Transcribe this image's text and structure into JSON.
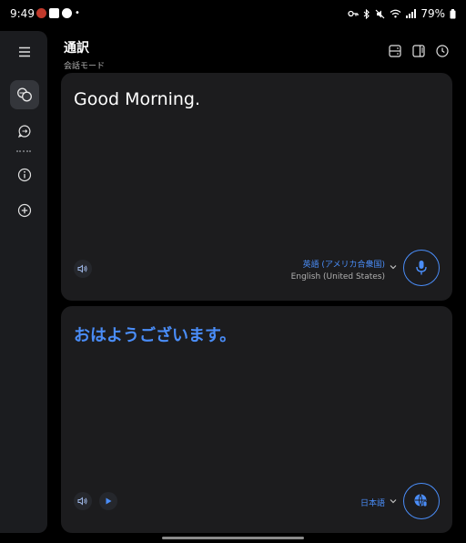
{
  "status_bar": {
    "time": "9:49",
    "notification_icons": [
      "app-notification-icon",
      "e-notification-icon",
      "message-notification-icon"
    ],
    "dot": "•",
    "battery": "79%"
  },
  "sidebar": {
    "items": [
      {
        "name": "menu-icon",
        "active": false
      },
      {
        "name": "conversation-icon",
        "active": true
      },
      {
        "name": "chat-icon",
        "active": false
      },
      {
        "name": "info-icon",
        "active": false
      },
      {
        "name": "add-icon",
        "active": false
      }
    ]
  },
  "header": {
    "title": "通訳",
    "subtitle": "会話モード"
  },
  "source_card": {
    "text": "Good Morning.",
    "language_primary": "英語 (アメリカ合衆国)",
    "language_secondary": "English (United States)"
  },
  "target_card": {
    "text": "おはようございます。",
    "language_primary": "日本語"
  },
  "colors": {
    "accent": "#4a8df8",
    "card": "#1c1c1e",
    "sidebar": "#1b1c1f",
    "background": "#000000"
  }
}
